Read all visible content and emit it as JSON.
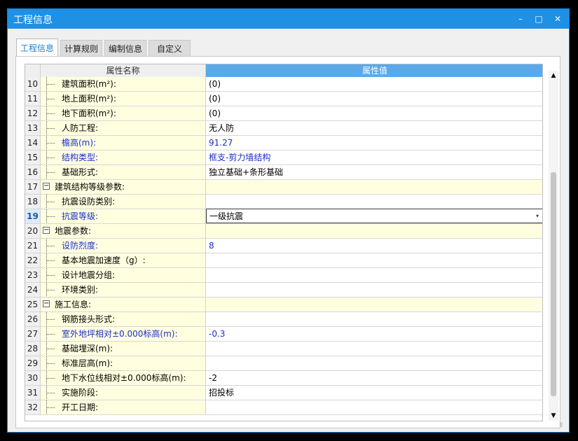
{
  "window": {
    "title": "工程信息",
    "controls": {
      "minimize": "–",
      "maximize": "□",
      "close": "✕"
    }
  },
  "tabs": [
    {
      "label": "工程信息",
      "active": true
    },
    {
      "label": "计算规则",
      "active": false
    },
    {
      "label": "编制信息",
      "active": false
    },
    {
      "label": "自定义",
      "active": false
    }
  ],
  "grid": {
    "headers": {
      "name": "属性名称",
      "value": "属性值"
    },
    "rows": [
      {
        "num": "10",
        "name": "建筑面积(m²):",
        "value": "(0)"
      },
      {
        "num": "11",
        "name": "地上面积(m²):",
        "value": "(0)"
      },
      {
        "num": "12",
        "name": "地下面积(m²):",
        "value": "(0)"
      },
      {
        "num": "13",
        "name": "人防工程:",
        "value": "无人防"
      },
      {
        "num": "14",
        "name": "檐高(m):",
        "value": "91.27",
        "blue": true
      },
      {
        "num": "15",
        "name": "结构类型:",
        "value": "框支-剪力墙结构",
        "blue": true
      },
      {
        "num": "16",
        "name": "基础形式:",
        "value": "独立基础+条形基础"
      },
      {
        "num": "17",
        "name": "建筑结构等级参数:",
        "value": "",
        "group": true,
        "toggle": "−"
      },
      {
        "num": "18",
        "name": "抗震设防类别:",
        "value": ""
      },
      {
        "num": "19",
        "name": "抗震等级:",
        "value": "一级抗震",
        "blue": true,
        "selected": true
      },
      {
        "num": "20",
        "name": "地震参数:",
        "value": "",
        "group": true,
        "toggle": "−"
      },
      {
        "num": "21",
        "name": "设防烈度:",
        "value": "8",
        "blue": true
      },
      {
        "num": "22",
        "name": "基本地震加速度（g）:",
        "value": ""
      },
      {
        "num": "23",
        "name": "设计地震分组:",
        "value": ""
      },
      {
        "num": "24",
        "name": "环境类别:",
        "value": ""
      },
      {
        "num": "25",
        "name": "施工信息:",
        "value": "",
        "group": true,
        "toggle": "−"
      },
      {
        "num": "26",
        "name": "钢筋接头形式:",
        "value": ""
      },
      {
        "num": "27",
        "name": "室外地坪相对±0.000标高(m):",
        "value": "-0.3",
        "blue": true
      },
      {
        "num": "28",
        "name": "基础埋深(m):",
        "value": ""
      },
      {
        "num": "29",
        "name": "标准层高(m):",
        "value": ""
      },
      {
        "num": "30",
        "name": "地下水位线相对±0.000标高(m):",
        "value": "-2"
      },
      {
        "num": "31",
        "name": "实施阶段:",
        "value": "招投标"
      },
      {
        "num": "32",
        "name": "开工日期:",
        "value": ""
      }
    ]
  },
  "scrollbar": {
    "up": "▲",
    "down": "▼"
  },
  "dropdown_glyph": "▾",
  "colors": {
    "titlebar": "#1e90e6",
    "header_value": "#5aa9ea",
    "name_cell": "#ffffe0",
    "modified_text": "#1c2fc9"
  }
}
